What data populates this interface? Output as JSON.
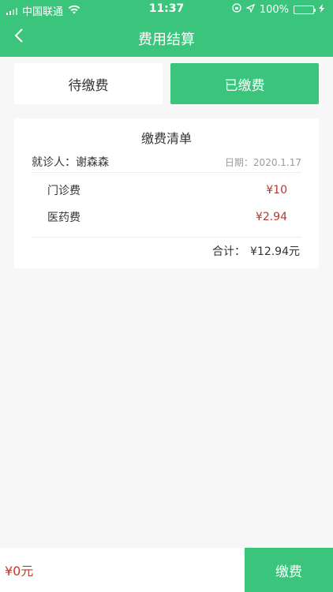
{
  "status_bar": {
    "carrier": "中国联通",
    "time": "11:37",
    "battery": "100%",
    "battery_level": 1.0
  },
  "nav": {
    "title": "费用结算",
    "back_icon": "chevron-left-icon"
  },
  "tabs": [
    {
      "label": "待缴费",
      "active": false
    },
    {
      "label": "已缴费",
      "active": true
    }
  ],
  "bill": {
    "title": "缴费清单",
    "patient_label": "就诊人：谢森森",
    "date_label": "日期：2020.1.17",
    "items": [
      {
        "name": "门诊费",
        "amount": "¥10"
      },
      {
        "name": "医药费",
        "amount": "¥2.94"
      }
    ],
    "total_label": "合计：",
    "total_value": "¥12.94元"
  },
  "bottom": {
    "amount": "¥0元",
    "pay_label": "缴费"
  },
  "colors": {
    "brand": "#3bc47b",
    "price_red": "#b53a2f"
  }
}
